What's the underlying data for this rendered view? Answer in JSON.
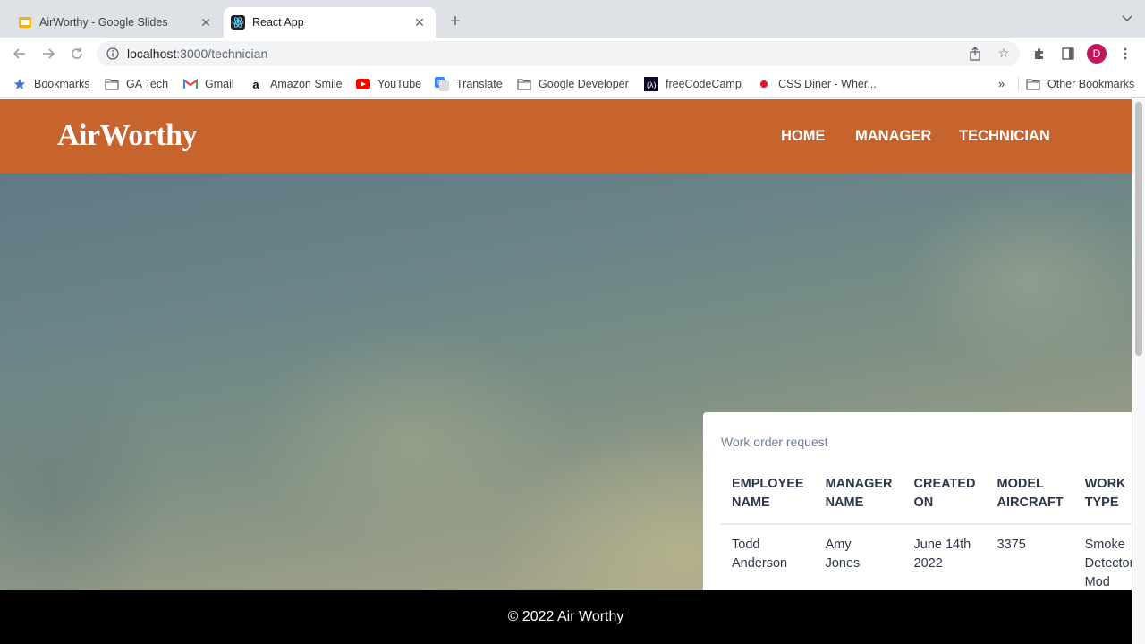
{
  "browser": {
    "tabs": [
      {
        "title": "AirWorthy - Google Slides",
        "icon": "google-slides-icon",
        "active": false
      },
      {
        "title": "React App",
        "icon": "react-icon",
        "active": true
      }
    ],
    "url_host": "localhost",
    "url_path": ":3000/technician",
    "avatar_letter": "D",
    "bookmarks": [
      {
        "label": "Bookmarks",
        "icon": "star-icon"
      },
      {
        "label": "GA Tech",
        "icon": "folder-icon"
      },
      {
        "label": "Gmail",
        "icon": "gmail-icon"
      },
      {
        "label": "Amazon Smile",
        "icon": "amazon-icon"
      },
      {
        "label": "YouTube",
        "icon": "youtube-icon"
      },
      {
        "label": "Translate",
        "icon": "translate-icon"
      },
      {
        "label": "Google Developer",
        "icon": "folder-icon"
      },
      {
        "label": "freeCodeCamp",
        "icon": "freecodecamp-icon"
      },
      {
        "label": "CSS Diner - Wher...",
        "icon": "css-diner-icon"
      }
    ],
    "overflow_label": "»",
    "other_bookmarks": "Other Bookmarks"
  },
  "app": {
    "logo": "AirWorthy",
    "nav": [
      "HOME",
      "MANAGER",
      "TECHNICIAN"
    ],
    "brand_color": "#c7632c"
  },
  "work_order": {
    "title": "Work order request",
    "columns": [
      [
        "EMPLOYEE",
        "NAME"
      ],
      [
        "MANAGER",
        "NAME"
      ],
      [
        "CREATED",
        "ON"
      ],
      [
        "MODEL",
        "AIRCRAFT"
      ],
      [
        "WORK",
        "TYPE"
      ]
    ],
    "rows": [
      [
        [
          "Todd",
          "Anderson"
        ],
        [
          "Amy",
          "Jones"
        ],
        [
          "June 14th",
          "2022"
        ],
        [
          "3375"
        ],
        [
          "Smoke",
          "Detector",
          "Mod"
        ]
      ]
    ]
  },
  "footer": {
    "text": "© 2022 Air Worthy"
  }
}
